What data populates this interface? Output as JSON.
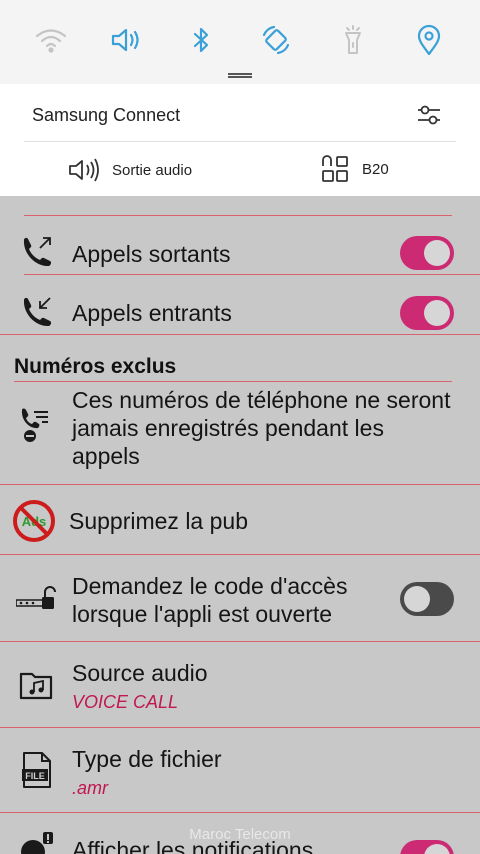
{
  "quick_settings": {
    "icons": [
      "wifi-icon",
      "volume-icon",
      "bluetooth-icon",
      "auto-rotate-icon",
      "flashlight-icon",
      "location-icon"
    ],
    "accent_color": "#3aa0d8",
    "samsung_connect": "Samsung Connect",
    "audio_output": "Sortie audio",
    "device": "B20"
  },
  "rows": {
    "outgoing": {
      "label": "Appels sortants",
      "enabled": true
    },
    "incoming": {
      "label": "Appels entrants",
      "enabled": true
    },
    "excluded_header": "Numéros exclus",
    "excluded_desc": "Ces numéros de téléphone ne seront jamais enregistrés pendant les appels",
    "remove_ads": "Supprimez la pub",
    "ads_badge": "Ads",
    "passcode": {
      "label": "Demandez le code d'accès lorsque l'appli est ouverte",
      "enabled": false
    },
    "audio_source": {
      "label": "Source audio",
      "value": "VOICE CALL"
    },
    "file_type": {
      "label": "Type de fichier",
      "value": ".amr",
      "icon_text": "FILE"
    },
    "notifications": {
      "label": "Afficher les notifications",
      "enabled": true
    }
  },
  "colors": {
    "toggle_on": "#cc2a72",
    "divider": "#d9646e",
    "value_text": "#c0184f"
  },
  "watermark": "Maroc Telecom"
}
